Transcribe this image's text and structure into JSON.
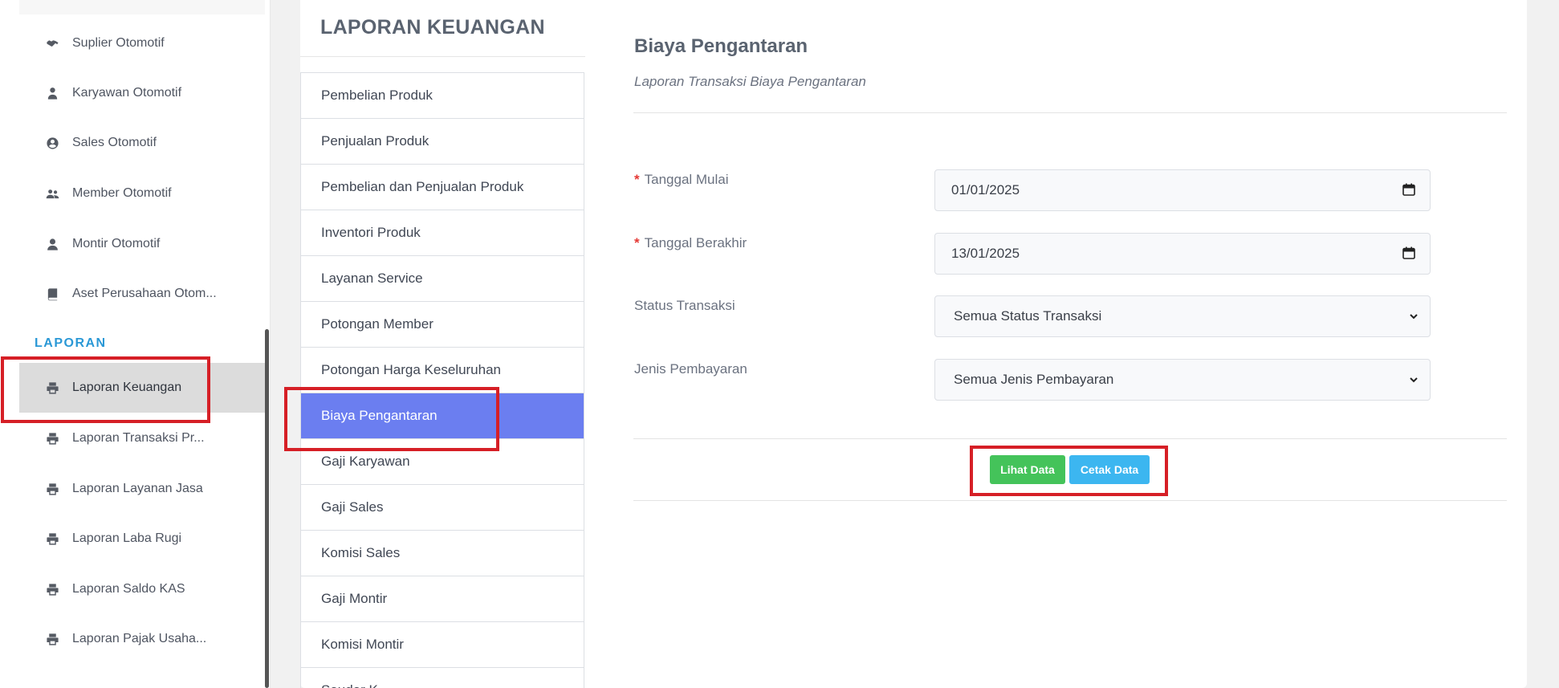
{
  "sidebar": {
    "items_top": [
      {
        "label": "Suplier Otomotif",
        "icon": "handshake-icon"
      },
      {
        "label": "Karyawan Otomotif",
        "icon": "user-tie-icon"
      },
      {
        "label": "Sales Otomotif",
        "icon": "user-circle-icon"
      },
      {
        "label": "Member Otomotif",
        "icon": "users-icon"
      },
      {
        "label": "Montir Otomotif",
        "icon": "user-icon"
      },
      {
        "label": "Aset Perusahaan Otom..."
      }
    ],
    "section_label": "LAPORAN",
    "items_laporan": [
      {
        "label": "Laporan Keuangan",
        "icon": "printer-icon"
      },
      {
        "label": "Laporan Transaksi Pr..."
      },
      {
        "label": "Laporan Layanan Jasa"
      },
      {
        "label": "Laporan Laba Rugi"
      },
      {
        "label": "Laporan Saldo KAS"
      },
      {
        "label": "Laporan Pajak Usaha..."
      }
    ]
  },
  "report_menu": {
    "heading": "LAPORAN KEUANGAN",
    "items": [
      {
        "label": "Pembelian Produk"
      },
      {
        "label": "Penjualan Produk"
      },
      {
        "label": "Pembelian dan Penjualan Produk"
      },
      {
        "label": "Inventori Produk"
      },
      {
        "label": "Layanan Service"
      },
      {
        "label": "Potongan Member"
      },
      {
        "label": "Potongan Harga Keseluruhan"
      },
      {
        "label": "Biaya Pengantaran"
      },
      {
        "label": "Gaji Karyawan"
      },
      {
        "label": "Gaji Sales"
      },
      {
        "label": "Komisi Sales"
      },
      {
        "label": "Gaji Montir"
      },
      {
        "label": "Komisi Montir"
      },
      {
        "label": "Saudar K..."
      }
    ]
  },
  "content": {
    "title": "Biaya Pengantaran",
    "subtitle": "Laporan Transaksi Biaya Pengantaran",
    "form": {
      "required_mark": "*",
      "tanggal_mulai_label": "Tanggal Mulai",
      "tanggal_mulai_value": "01/01/2025",
      "tanggal_berakhir_label": "Tanggal Berakhir",
      "tanggal_berakhir_value": "13/01/2025",
      "status_label": "Status Transaksi",
      "status_value": "Semua Status Transaksi",
      "jenis_label": "Jenis Pembayaran",
      "jenis_value": "Semua Jenis Pembayaran"
    },
    "buttons": {
      "lihat": "Lihat Data",
      "cetak": "Cetak Data"
    }
  },
  "colors": {
    "active_menu": "#6b7ef0",
    "section_label": "#2a98d6",
    "btn_lihat": "#44c35a",
    "btn_cetak": "#3cb6f0",
    "highlight": "#d61f26"
  }
}
